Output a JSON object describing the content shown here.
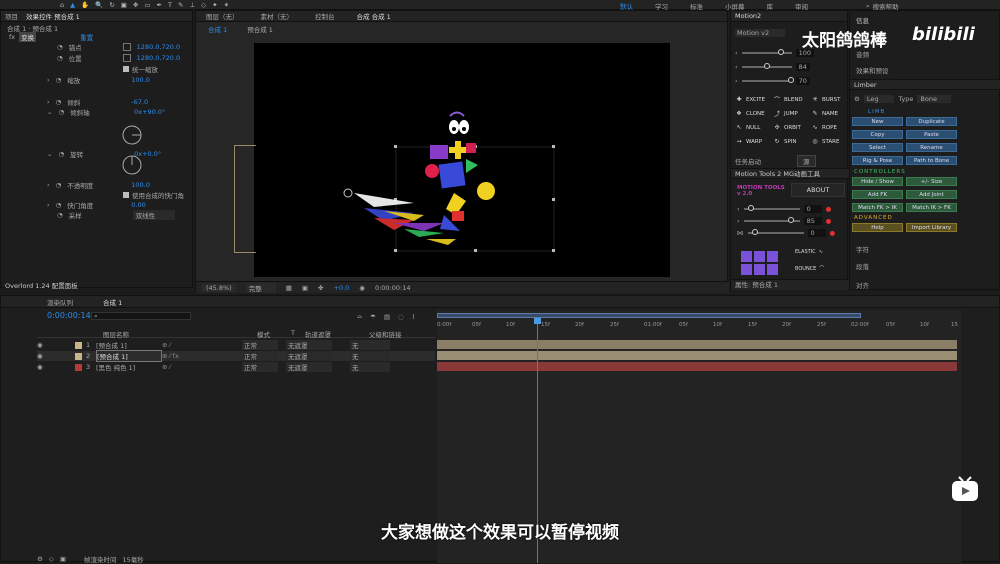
{
  "menu": {
    "items": [
      "默认",
      "学习",
      "标准",
      "小屏幕",
      "库",
      "审阅"
    ],
    "search_placeholder": "搜索帮助"
  },
  "brand": {
    "watermark": "太阳鸽鸽棒",
    "logo_text": "bilibili"
  },
  "project_panel": {
    "tabs": [
      "项目",
      "效果控件 预合成 1"
    ],
    "comp_path": "合成 1 · 预合成 1"
  },
  "effects": {
    "transform_label": "变换",
    "reset": "重置",
    "anchor_label": "锚点",
    "anchor_val": "1280.0,720.0",
    "position_label": "位置",
    "position_val": "1280.0,720.0",
    "uniform_scale": "统一缩放",
    "scale_label": "缩放",
    "scale_val": "100.0",
    "skew_label": "倾斜",
    "skew_val": "-67.0",
    "skew_axis_label": "倾斜轴",
    "skew_axis_val": "0x+90.0°",
    "rotation_label": "旋转",
    "rotation_val": "0x+0.0°",
    "opacity_label": "不透明度",
    "opacity_val": "100.0",
    "use_comp_shutter": "使用合成的快门角",
    "shutter_label": "快门角度",
    "shutter_val": "0.00",
    "sampling_label": "采样",
    "sampling_val": "双线性"
  },
  "overlord_label": "Overlord 1.24 配置面板",
  "viewer": {
    "tabs": [
      "图层（无）",
      "素材（无）",
      "控制台",
      "合成 合成 1"
    ],
    "breadcrumb": [
      "合成 1",
      "预合成 1"
    ],
    "zoom": "(45.8%)",
    "quality": "完整",
    "exposure": "+0.0",
    "timecode": "0:00:00:14"
  },
  "motion2": {
    "title": "Motion2",
    "preset": "Motion v2",
    "vals": [
      "100",
      "84",
      "70"
    ],
    "tools": [
      "EXCITE",
      "BLEND",
      "BURST",
      "CLONE",
      "JUMP",
      "NAME",
      "NULL",
      "ORBIT",
      "ROPE",
      "WARP",
      "SPIN",
      "STARE"
    ],
    "task_label": "任务启动",
    "task_btn": "源"
  },
  "mt2": {
    "title": "Motion Tools 2 MG动画工具",
    "brand": "MOTION TOOLS v 2.0",
    "about": "ABOUT",
    "vals": [
      "0",
      "85",
      "0"
    ],
    "elastic": "ELASTIC",
    "bounce": "BOUNCE"
  },
  "props_label": "属性: 预合成 1",
  "limber": {
    "info": "信息",
    "audio": "音频",
    "effects_presets": "效果和预设",
    "title": "Limber",
    "leg": "Leg",
    "type_label": "Type",
    "type_val": "Bone",
    "limb_section": "LIMB",
    "limb_buttons": [
      "New",
      "Duplicate",
      "Copy",
      "Paste",
      "Select",
      "Rename",
      "Rig & Pose",
      "Path to Bone"
    ],
    "controllers_section": "CONTROLLERS",
    "controller_buttons": [
      "Hide / Show",
      "+/- Size",
      "Add FK",
      "Add Joint",
      "Match FK > IK",
      "Match IK > FK"
    ],
    "advanced_section": "ADVANCED",
    "advanced_buttons": [
      "Help",
      "Import Library"
    ],
    "chars": "字符",
    "paragraph": "段落",
    "align": "对齐"
  },
  "timeline": {
    "tabs": [
      "渲染队列",
      "合成 1"
    ],
    "timecode": "0:00:00:14",
    "columns": [
      "图层名称",
      "模式",
      "T",
      "轨道遮罩",
      "父级和链接"
    ],
    "ticks": [
      "0:00f",
      "05f",
      "10f",
      "15f",
      "20f",
      "25f",
      "01:00f",
      "05f",
      "10f",
      "15f",
      "20f",
      "25f",
      "02:00f",
      "05f",
      "10f",
      "15"
    ],
    "layers": [
      {
        "num": "1",
        "name": "[预合成 1]",
        "mode": "正常",
        "matte": "无遮罩",
        "parent": "无",
        "color": "#c8b58a"
      },
      {
        "num": "2",
        "name": "[预合成 1]",
        "mode": "正常",
        "matte": "无遮罩",
        "parent": "无",
        "color": "#c8b58a"
      },
      {
        "num": "3",
        "name": "[黑色 纯色 1]",
        "mode": "正常",
        "matte": "无遮罩",
        "parent": "无",
        "color": "#b53a3a"
      }
    ],
    "footer_label": "帧渲染时间",
    "footer_val": "15毫秒"
  },
  "subtitle": "大家想做这个效果可以暂停视频"
}
